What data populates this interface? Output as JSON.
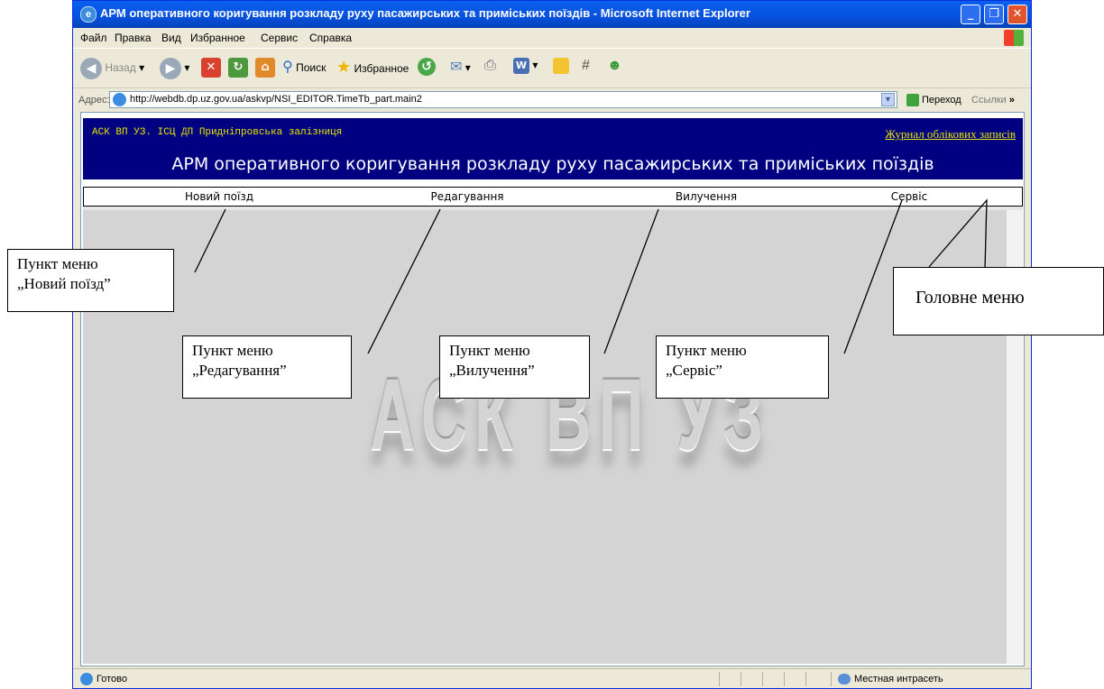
{
  "window": {
    "title": "АРМ оперативного коригування розкладу руху пасажирських та приміських поїздів - Microsoft Internet Explorer",
    "minimize": "_",
    "maximize": "❐",
    "close": "✕"
  },
  "menu_bar": [
    "Файл",
    "Правка",
    "Вид",
    "Избранное",
    "Сервис",
    "Справка"
  ],
  "toolbar": {
    "back": "Назад",
    "search": "Поиск",
    "favorites": "Избранное"
  },
  "address_bar": {
    "label": "Адрес:",
    "url": "http://webdb.dp.uz.gov.ua/askvp/NSI_EDITOR.TimeTb_part.main2",
    "go": "Переход",
    "links": "Ссылки",
    "more": "»"
  },
  "page": {
    "org": "АСК ВП УЗ. ІСЦ ДП Придніпровська залізниця",
    "journal_link": "Журнал облікових записів",
    "app_title": "АРМ оперативного коригування розкладу руху пасажирських та приміських поїздів",
    "main_menu": [
      "Новий поїзд",
      "Редагування",
      "Вилучення",
      "Сервіс"
    ],
    "watermark": "АСК ВП УЗ"
  },
  "status_bar": {
    "status": "Готово",
    "zone": "Местная интрасеть"
  },
  "annotations": {
    "new_train": [
      "Пункт меню",
      "„Новий поїзд”"
    ],
    "editing": [
      "Пункт меню",
      "„Редагування”"
    ],
    "removal": [
      "Пункт меню",
      "„Вилучення”"
    ],
    "service": [
      "Пункт меню",
      "„Сервіс”"
    ],
    "main_menu": "Головне меню"
  }
}
